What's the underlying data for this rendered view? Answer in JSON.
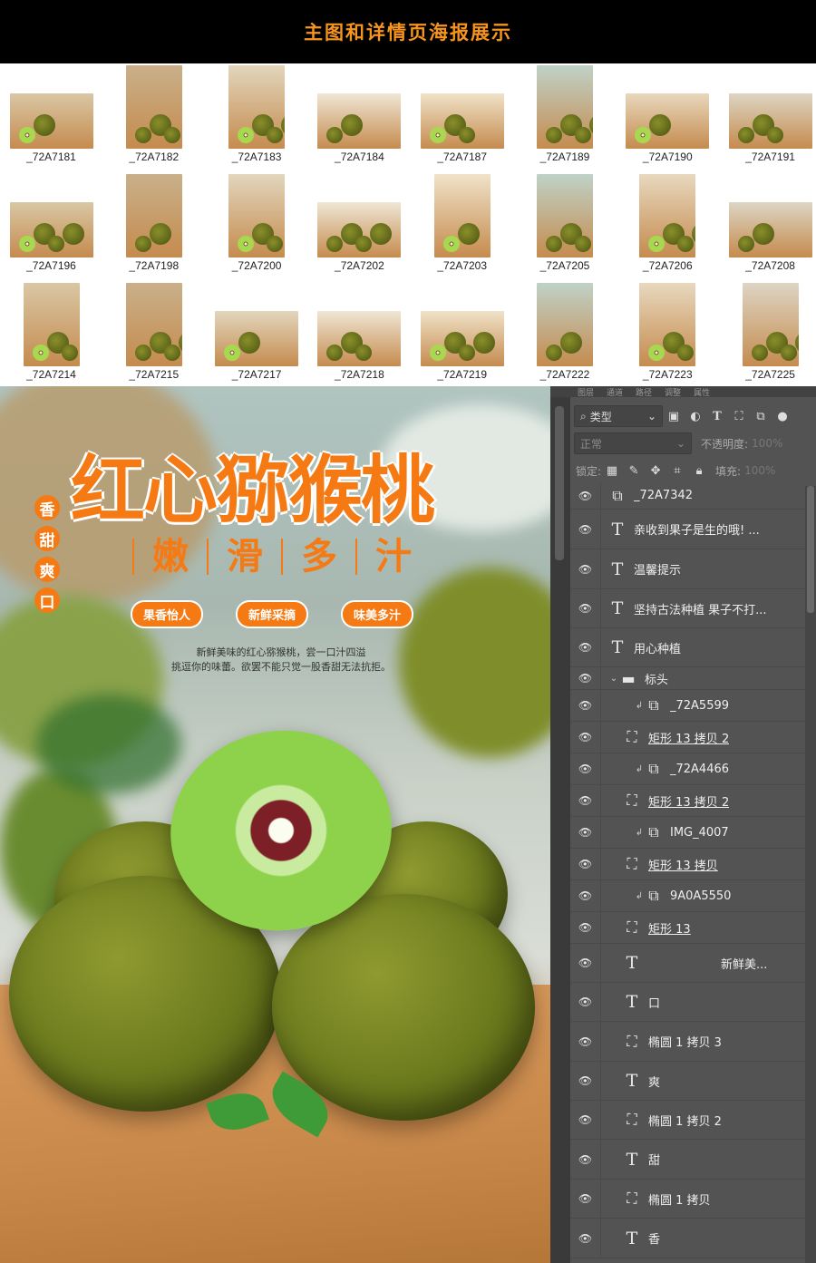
{
  "header": {
    "title": "主图和详情页海报展示",
    "accent": "#f7941d"
  },
  "thumbnails": [
    {
      "label": "_72A7181"
    },
    {
      "label": "_72A7182"
    },
    {
      "label": "_72A7183"
    },
    {
      "label": "_72A7184"
    },
    {
      "label": "_72A7187"
    },
    {
      "label": "_72A7189"
    },
    {
      "label": "_72A7190"
    },
    {
      "label": "_72A7191"
    },
    {
      "label": "_72A7196"
    },
    {
      "label": "_72A7198"
    },
    {
      "label": "_72A7200"
    },
    {
      "label": "_72A7202"
    },
    {
      "label": "_72A7203"
    },
    {
      "label": "_72A7205"
    },
    {
      "label": "_72A7206"
    },
    {
      "label": "_72A7208"
    },
    {
      "label": "_72A7214"
    },
    {
      "label": "_72A7215"
    },
    {
      "label": "_72A7217"
    },
    {
      "label": "_72A7218"
    },
    {
      "label": "_72A7219"
    },
    {
      "label": "_72A7222"
    },
    {
      "label": "_72A7223"
    },
    {
      "label": "_72A7225"
    }
  ],
  "poster": {
    "title": "红心猕猴桃",
    "subtitle": [
      "嫩",
      "滑",
      "多",
      "汁"
    ],
    "vertical": [
      "香",
      "甜",
      "爽",
      "口"
    ],
    "tags": [
      "果香怡人",
      "新鲜采摘",
      "味美多汁"
    ],
    "desc_line1": "新鲜美味的红心猕猴桃，尝一口汁四溢",
    "desc_line2": "挑逗你的味蕾。欲罢不能只觉一股香甜无法抗拒。",
    "accent": "#f57a14"
  },
  "ps": {
    "tabs": [
      "图层",
      "通道",
      "路径",
      "调整",
      "属性"
    ],
    "filter_label": "类型",
    "blend_mode": "正常",
    "opacity_label": "不透明度:",
    "opacity_value": "100%",
    "lock_label": "锁定:",
    "fill_label": "填充:",
    "fill_value": "100%",
    "layers": [
      {
        "name": "_72A7342",
        "icon": "smart-object-icon"
      },
      {
        "name": "亲收到果子是生的哦! ...",
        "icon": "text-icon"
      },
      {
        "name": "温馨提示",
        "icon": "text-icon"
      },
      {
        "name": "坚持古法种植 果子不打...",
        "icon": "text-icon"
      },
      {
        "name": "用心种植",
        "icon": "text-icon"
      },
      {
        "name": "标头",
        "icon": "folder-icon"
      },
      {
        "name": "_72A5599",
        "icon": "smart-object-icon"
      },
      {
        "name": "矩形 13 拷贝 2",
        "icon": "shape-icon"
      },
      {
        "name": "_72A4466",
        "icon": "smart-object-icon"
      },
      {
        "name": "矩形 13 拷贝 2",
        "icon": "shape-icon"
      },
      {
        "name": "IMG_4007",
        "icon": "smart-object-icon"
      },
      {
        "name": "矩形 13 拷贝",
        "icon": "shape-icon"
      },
      {
        "name": "9A0A5550",
        "icon": "smart-object-icon"
      },
      {
        "name": "矩形 13",
        "icon": "shape-icon"
      },
      {
        "name": "新鲜美...",
        "icon": "text-icon"
      },
      {
        "name": "口",
        "icon": "text-icon"
      },
      {
        "name": "椭圆 1 拷贝 3",
        "icon": "shape-icon"
      },
      {
        "name": "爽",
        "icon": "text-icon"
      },
      {
        "name": "椭圆 1 拷贝 2",
        "icon": "shape-icon"
      },
      {
        "name": "甜",
        "icon": "text-icon"
      },
      {
        "name": "椭圆 1 拷贝",
        "icon": "shape-icon"
      },
      {
        "name": "香",
        "icon": "text-icon"
      }
    ]
  }
}
